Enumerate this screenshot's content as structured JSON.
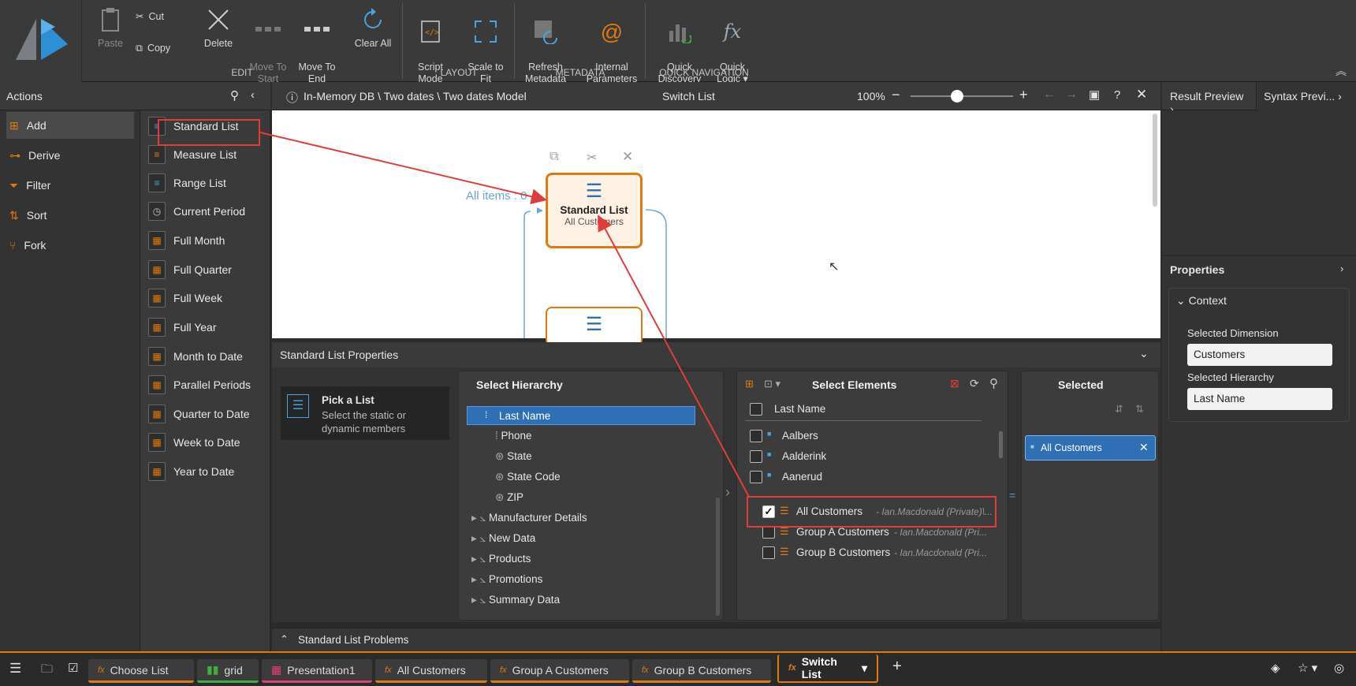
{
  "ribbon": {
    "paste": "Paste",
    "cut": "Cut",
    "copy": "Copy",
    "delete": "Delete",
    "move_to_start": "Move To\nStart",
    "move_to_end": "Move To\nEnd",
    "clear_all": "Clear All",
    "group_edit": "EDIT",
    "script_mode": "Script\nMode",
    "scale_to_fit": "Scale to\nFit",
    "group_layout": "LAYOUT",
    "refresh_metadata": "Refresh\nMetadata",
    "internal_parameters": "Internal\nParameters",
    "group_metadata": "METADATA",
    "quick_discovery": "Quick\nDiscovery",
    "quick_logic": "Quick\nLogic ▾",
    "group_quick_nav": "QUICK NAVIGATION"
  },
  "actions": {
    "title": "Actions",
    "items": [
      "Add",
      "Derive",
      "Filter",
      "Sort",
      "Fork"
    ]
  },
  "list_types": [
    "Standard List",
    "Measure List",
    "Range List",
    "Current Period",
    "Full Month",
    "Full Quarter",
    "Full Week",
    "Full Year",
    "Month to Date",
    "Parallel Periods",
    "Quarter to Date",
    "Week to Date",
    "Year to Date"
  ],
  "breadcrumb": {
    "path": "In-Memory DB \\ Two dates \\ Two dates Model",
    "title": "Switch List",
    "zoom": "100%",
    "zoom_fraction": 0.45
  },
  "canvas": {
    "all_items": "All items : 0",
    "node_title": "Standard List",
    "node_subtitle": "All Customers"
  },
  "properties_panel": {
    "title": "Standard List Properties",
    "pick_title": "Pick a List",
    "pick_desc": "Select the static or dynamic members",
    "hierarchy_title": "Select Hierarchy",
    "hierarchy_items": [
      {
        "label": "Last Name",
        "selected": true
      },
      {
        "label": "Phone"
      },
      {
        "label": "State"
      },
      {
        "label": "State Code"
      },
      {
        "label": "ZIP"
      }
    ],
    "hierarchy_groups": [
      "Manufacturer Details",
      "New Data",
      "Products",
      "Promotions",
      "Summary Data"
    ],
    "elements_title": "Select Elements",
    "elements_column": "Last Name",
    "elements": [
      "Aalbers",
      "Aalderink",
      "Aanerud"
    ],
    "lists": [
      {
        "name": "All Customers",
        "owner": "- Ian.Macdonald (Private)\\...",
        "checked": true
      },
      {
        "name": "Group A Customers",
        "owner": "- Ian.Macdonald (Pri...",
        "checked": false
      },
      {
        "name": "Group B Customers",
        "owner": "- Ian.Macdonald (Pri...",
        "checked": false
      }
    ],
    "selected_title": "Selected",
    "selected_chip": "All Customers",
    "problems_title": "Standard List Problems"
  },
  "right_panel": {
    "tab_result": "Result Preview",
    "tab_syntax": "Syntax Previ...",
    "props_title": "Properties",
    "context_title": "Context",
    "dimension_label": "Selected Dimension",
    "dimension_value": "Customers",
    "hierarchy_label": "Selected Hierarchy",
    "hierarchy_value": "Last Name"
  },
  "taskbar": {
    "tabs": [
      {
        "label": "Choose List",
        "accent": "#e07a10"
      },
      {
        "label": "grid",
        "accent": "#3cb043"
      },
      {
        "label": "Presentation1",
        "accent": "#e0407a"
      },
      {
        "label": "All Customers",
        "accent": "#e07a10"
      },
      {
        "label": "Group A Customers",
        "accent": "#e07a10"
      },
      {
        "label": "Group B Customers",
        "accent": "#e07a10"
      },
      {
        "label": "Switch List",
        "accent": "#e07a10"
      }
    ]
  },
  "colors": {
    "accent": "#e07a10",
    "selection": "#2f6fb5",
    "annotation": "#e03c3c"
  }
}
